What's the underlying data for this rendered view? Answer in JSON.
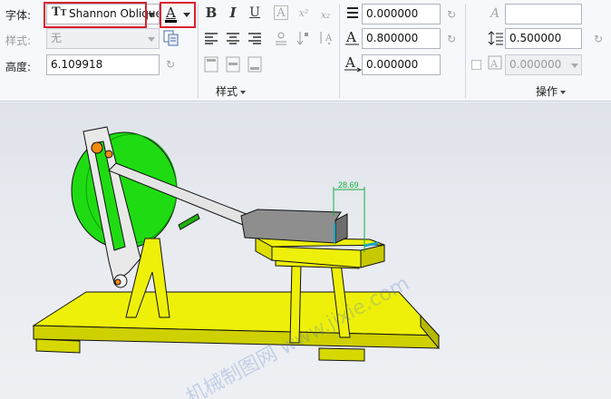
{
  "ribbon": {
    "font": {
      "label": "字体:",
      "value": "Shannon Oblique",
      "icon": "truetype-font-icon"
    },
    "text_color": {
      "icon": "text-color-icon",
      "letter": "A",
      "color": "#000000"
    },
    "style": {
      "label": "样式:",
      "value": "无"
    },
    "height": {
      "label": "高度:",
      "value": "6.109918"
    },
    "format_buttons": {
      "bold": "B",
      "italic": "I",
      "underline": "U",
      "frame": "A",
      "superscript": "x²",
      "subscript": "x₂"
    },
    "fields": {
      "slant_angle": "0.000000",
      "width_factor": "0.800000",
      "char_spacing": "0.000000",
      "line_spacing": "0.500000",
      "mirror_value": "0.000000"
    },
    "groups": {
      "style": "样式",
      "operations": "操作"
    }
  },
  "viewport": {
    "dimension_text": "28.69",
    "watermark": "机械制图网 www.jixie.com",
    "colors": {
      "flywheel": "#1fdc12",
      "base": "#eef00a",
      "link": "#e4e4e4",
      "slider": "#8e8e8e",
      "dimension": "#13b13b",
      "pin": "#f08b12"
    }
  }
}
